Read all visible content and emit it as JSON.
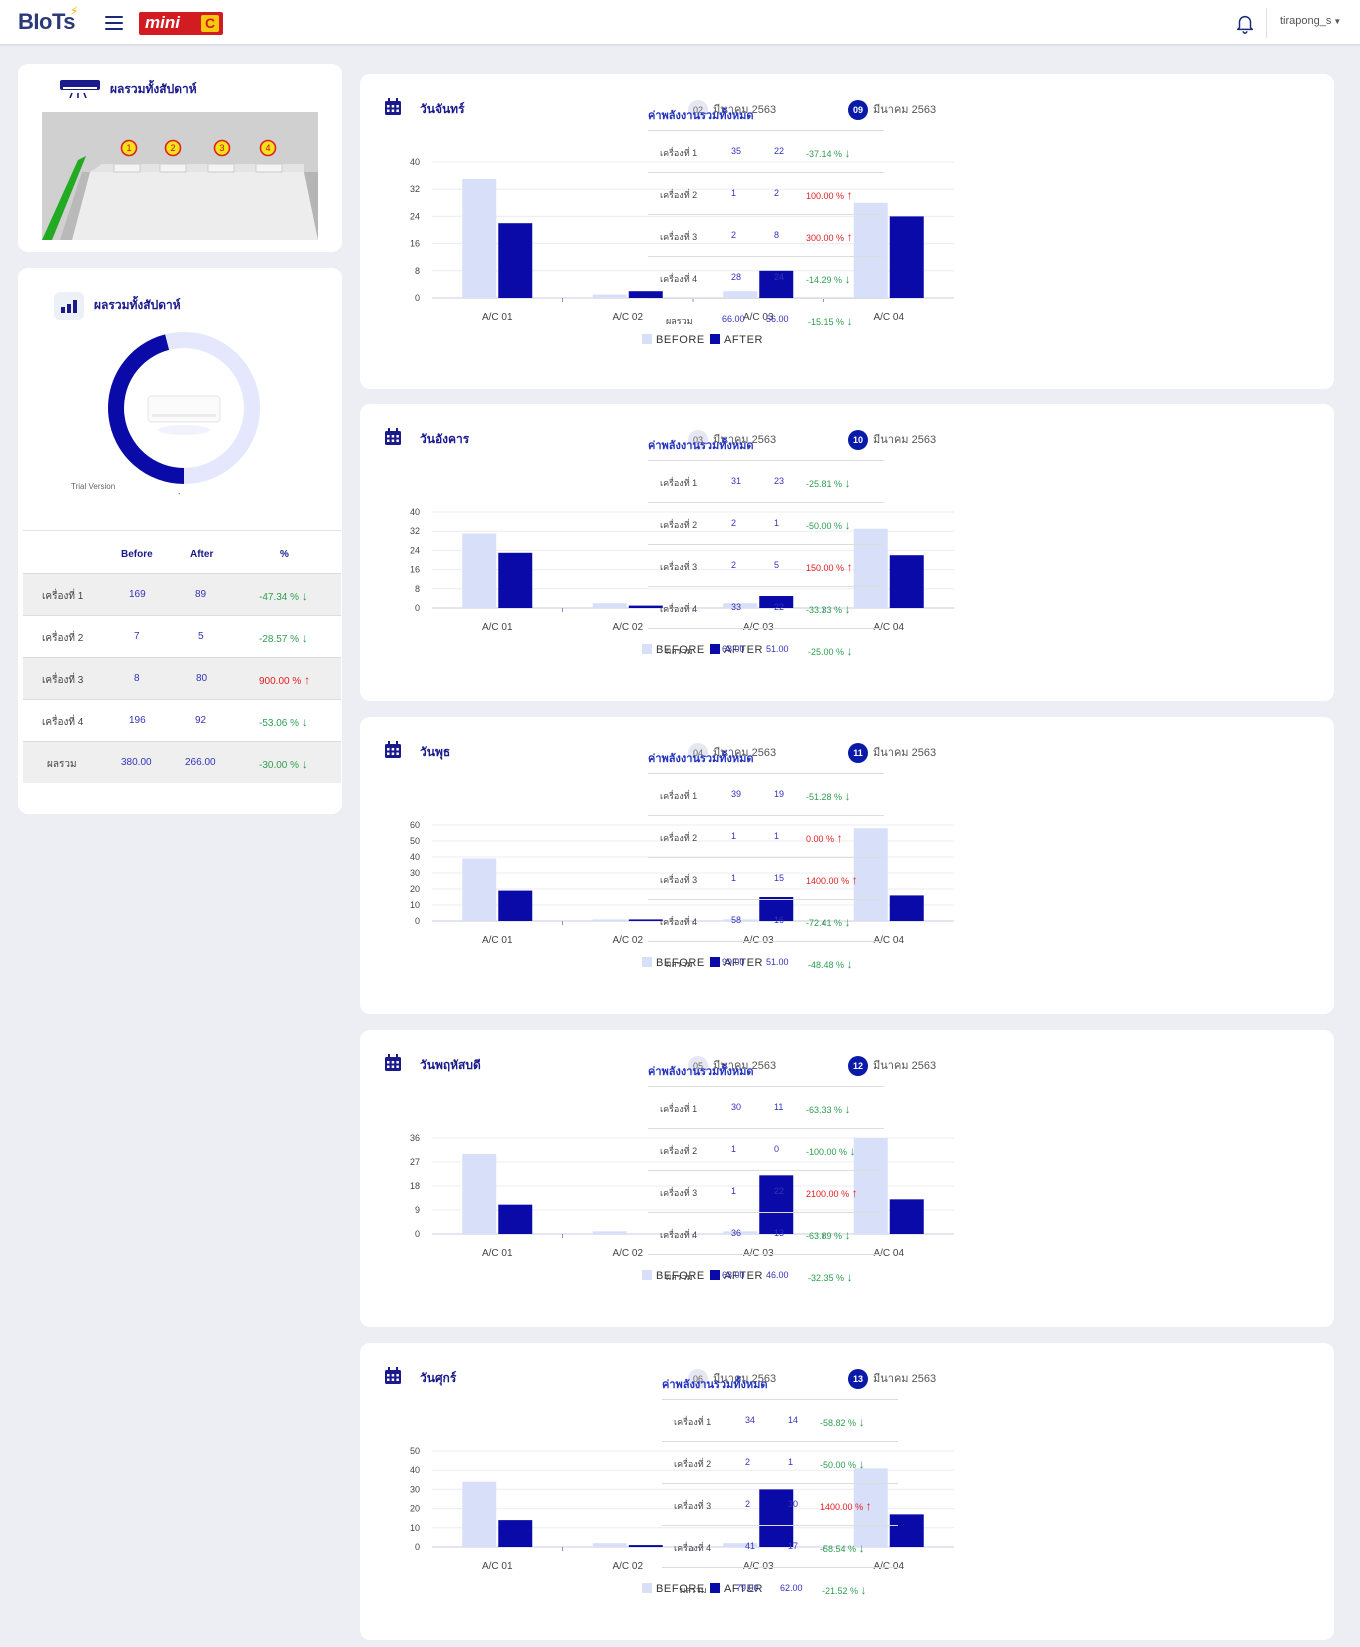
{
  "header": {
    "logo_text": "BIoTs",
    "brand_text": "mini",
    "brand_badge": "C",
    "username": "tirapong_s"
  },
  "room_card": {
    "title": "ผลรวมทั้งสัปดาห์",
    "unit_markers": [
      "1",
      "2",
      "3",
      "4"
    ]
  },
  "weekly_card": {
    "title": "ผลรวมทั้งสัปดาห์",
    "trial_text": "Trial Version",
    "tick_text": "`",
    "donut": {
      "before_pct": 46,
      "after_pct": 54
    },
    "table": {
      "headers": [
        "Before",
        "After",
        "%"
      ],
      "rows": [
        {
          "label": "เครื่องที่ 1",
          "before": "169",
          "after": "89",
          "pct": "-47.34",
          "trend": "down"
        },
        {
          "label": "เครื่องที่ 2",
          "before": "7",
          "after": "5",
          "pct": "-28.57",
          "trend": "down"
        },
        {
          "label": "เครื่องที่ 3",
          "before": "8",
          "after": "80",
          "pct": "900.00",
          "trend": "up"
        },
        {
          "label": "เครื่องที่ 4",
          "before": "196",
          "after": "92",
          "pct": "-53.06",
          "trend": "down"
        },
        {
          "label": "ผลรวม",
          "before": "380.00",
          "after": "266.00",
          "pct": "-30.00",
          "trend": "down"
        }
      ]
    }
  },
  "labels": {
    "summary_title": "ค่าพลังงานรวมทั้งหมด",
    "pct_sign": "%",
    "before": "BEFORE",
    "after": "AFTER"
  },
  "colors": {
    "before": "#d8dff9",
    "after": "#0a0aa8",
    "up": "#e02020",
    "down": "#2e9e4e",
    "title": "#1a1a8c"
  },
  "days": [
    {
      "name": "วันจันทร์",
      "before_date": {
        "num": "02",
        "text": "มีนาคม 2563"
      },
      "after_date": {
        "num": "09",
        "text": "มีนาคม 2563"
      },
      "summary": [
        {
          "label": "เครื่องที่ 1",
          "before": "35",
          "after": "22",
          "pct": "-37.14",
          "trend": "down"
        },
        {
          "label": "เครื่องที่ 2",
          "before": "1",
          "after": "2",
          "pct": "100.00",
          "trend": "up"
        },
        {
          "label": "เครื่องที่ 3",
          "before": "2",
          "after": "8",
          "pct": "300.00",
          "trend": "up"
        },
        {
          "label": "เครื่องที่ 4",
          "before": "28",
          "after": "24",
          "pct": "-14.29",
          "trend": "down"
        },
        {
          "label": "ผลรวม",
          "before": "66.00",
          "after": "56.00",
          "pct": "-15.15",
          "trend": "down"
        }
      ],
      "chart_data": {
        "type": "bar",
        "categories": [
          "A/C 01",
          "A/C 02",
          "A/C 03",
          "A/C 04"
        ],
        "series": [
          {
            "name": "BEFORE",
            "values": [
              35,
              1,
              2,
              28
            ]
          },
          {
            "name": "AFTER",
            "values": [
              22,
              2,
              8,
              24
            ]
          }
        ],
        "yticks": [
          0,
          8,
          16,
          24,
          32,
          40
        ],
        "ylim": [
          0,
          40
        ],
        "legend": "bottom-center"
      }
    },
    {
      "name": "วันอังคาร",
      "before_date": {
        "num": "03",
        "text": "มีนาคม 2563"
      },
      "after_date": {
        "num": "10",
        "text": "มีนาคม 2563"
      },
      "summary": [
        {
          "label": "เครื่องที่ 1",
          "before": "31",
          "after": "23",
          "pct": "-25.81",
          "trend": "down"
        },
        {
          "label": "เครื่องที่ 2",
          "before": "2",
          "after": "1",
          "pct": "-50.00",
          "trend": "down"
        },
        {
          "label": "เครื่องที่ 3",
          "before": "2",
          "after": "5",
          "pct": "150.00",
          "trend": "up"
        },
        {
          "label": "เครื่องที่ 4",
          "before": "33",
          "after": "22",
          "pct": "-33.33",
          "trend": "down"
        },
        {
          "label": "ผลรวม",
          "before": "68.00",
          "after": "51.00",
          "pct": "-25.00",
          "trend": "down"
        }
      ],
      "chart_data": {
        "type": "bar",
        "categories": [
          "A/C 01",
          "A/C 02",
          "A/C 03",
          "A/C 04"
        ],
        "series": [
          {
            "name": "BEFORE",
            "values": [
              31,
              2,
              2,
              33
            ]
          },
          {
            "name": "AFTER",
            "values": [
              23,
              1,
              5,
              22
            ]
          }
        ],
        "yticks": [
          0,
          8,
          16,
          24,
          32,
          40
        ],
        "ylim": [
          0,
          40
        ],
        "legend": "bottom-center"
      }
    },
    {
      "name": "วันพุธ",
      "before_date": {
        "num": "04",
        "text": "มีนาคม 2563"
      },
      "after_date": {
        "num": "11",
        "text": "มีนาคม 2563"
      },
      "summary": [
        {
          "label": "เครื่องที่ 1",
          "before": "39",
          "after": "19",
          "pct": "-51.28",
          "trend": "down"
        },
        {
          "label": "เครื่องที่ 2",
          "before": "1",
          "after": "1",
          "pct": "0.00",
          "trend": "up"
        },
        {
          "label": "เครื่องที่ 3",
          "before": "1",
          "after": "15",
          "pct": "1400.00",
          "trend": "up"
        },
        {
          "label": "เครื่องที่ 4",
          "before": "58",
          "after": "16",
          "pct": "-72.41",
          "trend": "down"
        },
        {
          "label": "ผลรวม",
          "before": "99.00",
          "after": "51.00",
          "pct": "-48.48",
          "trend": "down"
        }
      ],
      "chart_data": {
        "type": "bar",
        "categories": [
          "A/C 01",
          "A/C 02",
          "A/C 03",
          "A/C 04"
        ],
        "series": [
          {
            "name": "BEFORE",
            "values": [
              39,
              1,
              1,
              58
            ]
          },
          {
            "name": "AFTER",
            "values": [
              19,
              1,
              15,
              16
            ]
          }
        ],
        "yticks": [
          0,
          10,
          20,
          30,
          40,
          50,
          60
        ],
        "ylim": [
          0,
          60
        ],
        "legend": "bottom-center"
      }
    },
    {
      "name": "วันพฤหัสบดี",
      "before_date": {
        "num": "05",
        "text": "มีนาคม 2563"
      },
      "after_date": {
        "num": "12",
        "text": "มีนาคม 2563"
      },
      "summary": [
        {
          "label": "เครื่องที่ 1",
          "before": "30",
          "after": "11",
          "pct": "-63.33",
          "trend": "down"
        },
        {
          "label": "เครื่องที่ 2",
          "before": "1",
          "after": "0",
          "pct": "-100.00",
          "trend": "down"
        },
        {
          "label": "เครื่องที่ 3",
          "before": "1",
          "after": "22",
          "pct": "2100.00",
          "trend": "up"
        },
        {
          "label": "เครื่องที่ 4",
          "before": "36",
          "after": "13",
          "pct": "-63.89",
          "trend": "down"
        },
        {
          "label": "ผลรวม",
          "before": "68.00",
          "after": "46.00",
          "pct": "-32.35",
          "trend": "down"
        }
      ],
      "chart_data": {
        "type": "bar",
        "categories": [
          "A/C 01",
          "A/C 02",
          "A/C 03",
          "A/C 04"
        ],
        "series": [
          {
            "name": "BEFORE",
            "values": [
              30,
              1,
              1,
              36
            ]
          },
          {
            "name": "AFTER",
            "values": [
              11,
              0,
              22,
              13
            ]
          }
        ],
        "yticks": [
          0,
          9,
          18,
          27,
          36
        ],
        "ylim": [
          0,
          36
        ],
        "legend": "bottom-center"
      }
    },
    {
      "name": "วันศุกร์",
      "before_date": {
        "num": "06",
        "text": "มีนาคม 2563"
      },
      "after_date": {
        "num": "13",
        "text": "มีนาคม 2563"
      },
      "summary": [
        {
          "label": "เครื่องที่ 1",
          "before": "34",
          "after": "14",
          "pct": "-58.82",
          "trend": "down"
        },
        {
          "label": "เครื่องที่ 2",
          "before": "2",
          "after": "1",
          "pct": "-50.00",
          "trend": "down"
        },
        {
          "label": "เครื่องที่ 3",
          "before": "2",
          "after": "30",
          "pct": "1400.00",
          "trend": "up"
        },
        {
          "label": "เครื่องที่ 4",
          "before": "41",
          "after": "17",
          "pct": "-58.54",
          "trend": "down"
        },
        {
          "label": "ผลรวม",
          "before": "79.00",
          "after": "62.00",
          "pct": "-21.52",
          "trend": "down"
        }
      ],
      "chart_data": {
        "type": "bar",
        "categories": [
          "A/C 01",
          "A/C 02",
          "A/C 03",
          "A/C 04"
        ],
        "series": [
          {
            "name": "BEFORE",
            "values": [
              34,
              2,
              2,
              41
            ]
          },
          {
            "name": "AFTER",
            "values": [
              14,
              1,
              30,
              17
            ]
          }
        ],
        "yticks": [
          0,
          10,
          20,
          30,
          40,
          50
        ],
        "ylim": [
          0,
          50
        ],
        "legend": "bottom-center"
      }
    }
  ]
}
